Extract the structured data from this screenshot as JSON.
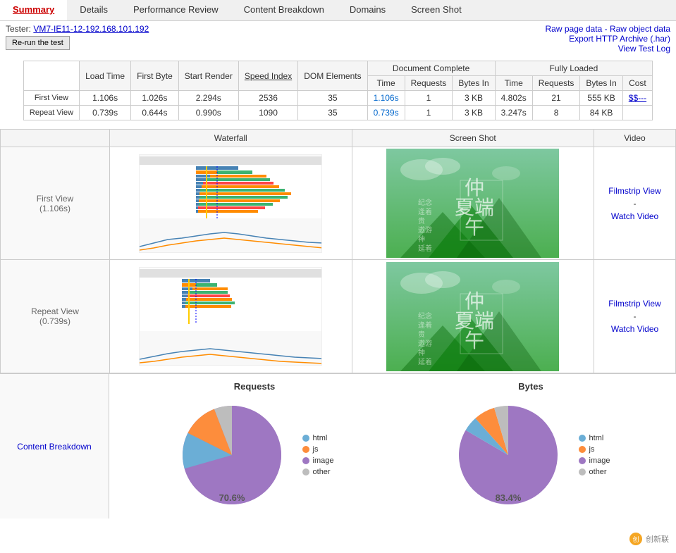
{
  "nav": {
    "items": [
      {
        "label": "Summary",
        "active": true
      },
      {
        "label": "Details",
        "active": false
      },
      {
        "label": "Performance Review",
        "active": false
      },
      {
        "label": "Content Breakdown",
        "active": false
      },
      {
        "label": "Domains",
        "active": false
      },
      {
        "label": "Screen Shot",
        "active": false
      }
    ]
  },
  "header": {
    "tester_label": "Tester:",
    "tester_value": "VM7-IE11-12-192.168.101.192",
    "rerun_label": "Re-run the test",
    "raw_page_data": "Raw page data",
    "raw_object_data": "Raw object data",
    "export_http": "Export HTTP Archive (.har)",
    "view_test_log": "View Test Log"
  },
  "stats": {
    "headers": {
      "load_time": "Load Time",
      "first_byte": "First Byte",
      "start_render": "Start Render",
      "speed_index": "Speed Index",
      "dom_elements": "DOM Elements",
      "document_complete": "Document Complete",
      "fully_loaded": "Fully Loaded",
      "time": "Time",
      "requests": "Requests",
      "bytes_in": "Bytes In",
      "cost": "Cost"
    },
    "rows": [
      {
        "label": "First View",
        "load_time": "1.106s",
        "first_byte": "1.026s",
        "start_render": "2.294s",
        "speed_index": "2536",
        "dom_elements": "35",
        "doc_time": "1.106s",
        "doc_requests": "1",
        "doc_bytes": "3 KB",
        "fl_time": "4.802s",
        "fl_requests": "21",
        "fl_bytes": "555 KB",
        "cost": "$$---"
      },
      {
        "label": "Repeat View",
        "load_time": "0.739s",
        "first_byte": "0.644s",
        "start_render": "0.990s",
        "speed_index": "1090",
        "dom_elements": "35",
        "doc_time": "0.739s",
        "doc_requests": "1",
        "doc_bytes": "3 KB",
        "fl_time": "3.247s",
        "fl_requests": "8",
        "fl_bytes": "84 KB",
        "cost": ""
      }
    ]
  },
  "waterfall": {
    "headers": {
      "col1": "",
      "col2": "Waterfall",
      "col3": "Screen Shot",
      "col4": "Video"
    },
    "rows": [
      {
        "label": "First View",
        "sublabel": "(1.106s)",
        "video_links": [
          "Filmstrip View",
          "-",
          "Watch Video"
        ]
      },
      {
        "label": "Repeat View",
        "sublabel": "(0.739s)",
        "video_links": [
          "Filmstrip View",
          "-",
          "Watch Video"
        ]
      }
    ]
  },
  "content_breakdown": {
    "label": "Content Breakdown",
    "requests_chart": {
      "title": "Requests",
      "legend": [
        {
          "label": "html",
          "color": "#6baed6"
        },
        {
          "label": "js",
          "color": "#fd8d3c"
        },
        {
          "label": "image",
          "color": "#9e77c2"
        },
        {
          "label": "other",
          "color": "#bdbdbd"
        }
      ],
      "center_label": "70.6%",
      "slices": [
        {
          "label": "image",
          "percent": 70.6,
          "color": "#9e77c2"
        },
        {
          "label": "html",
          "percent": 11.8,
          "color": "#6baed6"
        },
        {
          "label": "js",
          "percent": 11.8,
          "color": "#fd8d3c"
        },
        {
          "label": "other",
          "percent": 5.8,
          "color": "#bdbdbd"
        }
      ]
    },
    "bytes_chart": {
      "title": "Bytes",
      "legend": [
        {
          "label": "html",
          "color": "#6baed6"
        },
        {
          "label": "js",
          "color": "#fd8d3c"
        },
        {
          "label": "image",
          "color": "#9e77c2"
        },
        {
          "label": "other",
          "color": "#bdbdbd"
        }
      ],
      "center_label": "83.4%",
      "slices": [
        {
          "label": "image",
          "percent": 83.4,
          "color": "#9e77c2"
        },
        {
          "label": "html",
          "percent": 5.0,
          "color": "#6baed6"
        },
        {
          "label": "js",
          "percent": 7.0,
          "color": "#fd8d3c"
        },
        {
          "label": "other",
          "percent": 4.6,
          "color": "#bdbdbd"
        }
      ]
    }
  },
  "branding": {
    "text": "创新联"
  }
}
